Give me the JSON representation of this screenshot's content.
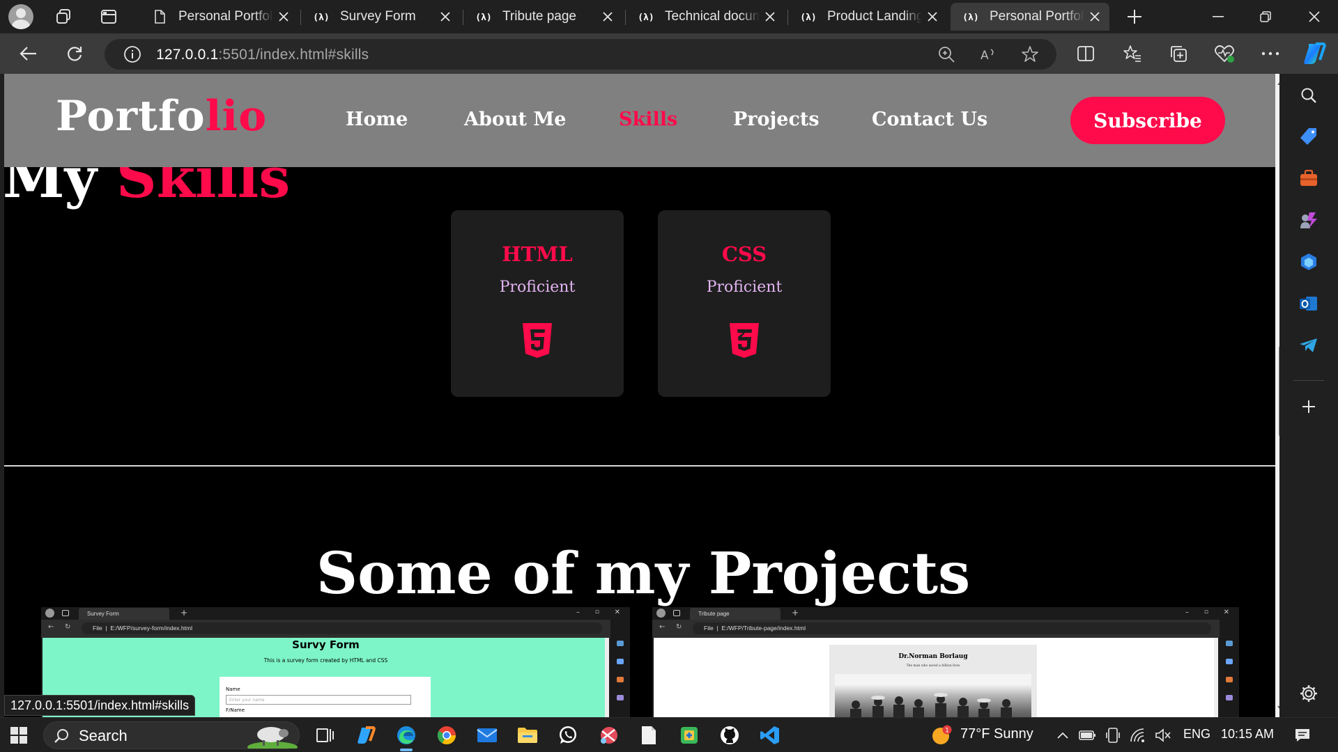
{
  "browser": {
    "tabs": [
      {
        "title": "Personal Portfolio",
        "icon": "page-icon",
        "active": false
      },
      {
        "title": "Survey Form",
        "icon": "freecodecamp-icon",
        "active": false
      },
      {
        "title": "Tribute page",
        "icon": "freecodecamp-icon",
        "active": false
      },
      {
        "title": "Technical document",
        "icon": "freecodecamp-icon",
        "active": false
      },
      {
        "title": "Product Landing",
        "icon": "freecodecamp-icon",
        "active": false
      },
      {
        "title": "Personal Portfolio",
        "icon": "freecodecamp-icon",
        "active": true
      }
    ],
    "url_host": "127.0.0.1",
    "url_rest": ":5501/index.html#skills",
    "status_link": "127.0.0.1:5501/index.html#skills"
  },
  "site": {
    "logo_main": "Portfo",
    "logo_accent": "lio",
    "nav": [
      {
        "label": "Home",
        "active": false
      },
      {
        "label": "About Me",
        "active": false
      },
      {
        "label": "Skills",
        "active": true
      },
      {
        "label": "Projects",
        "active": false
      },
      {
        "label": "Contact Us",
        "active": false
      }
    ],
    "subscribe_label": "Subscribe",
    "skills_heading_main": "My ",
    "skills_heading_accent": "Skills",
    "skills": [
      {
        "name": "HTML",
        "level": "Proficient",
        "icon": "html5-icon"
      },
      {
        "name": "CSS",
        "level": "Proficient",
        "icon": "css3-icon"
      }
    ],
    "projects_heading": "Some of my Projects",
    "projects": [
      {
        "tab_title": "Survey Form",
        "url": "E:/WFP/survey-form/index.html",
        "url_prefix": "File",
        "page_title": "Survy Form",
        "page_subtitle": "This is a survey form created by HTML and CSS",
        "field_label": "Name",
        "field_placeholder": "Enter your name",
        "field_label_2": "F/Name",
        "bg": "#7ef5c9"
      },
      {
        "tab_title": "Tribute page",
        "url": "E:/WFP/Tribute-page/index.html",
        "url_prefix": "File",
        "page_title": "Dr.Norman Borlaug",
        "page_subtitle": "The man who saved a billion lives",
        "bg": "#ffffff"
      }
    ]
  },
  "taskbar": {
    "search_label": "Search",
    "weather": "77°F  Sunny",
    "weather_badge": "1",
    "language": "ENG",
    "time": "10:15 AM"
  },
  "colors": {
    "accent": "#ff0a4a",
    "header_bg": "#808080",
    "card_bg": "#1e1e1e",
    "browser_dark": "#202020"
  }
}
